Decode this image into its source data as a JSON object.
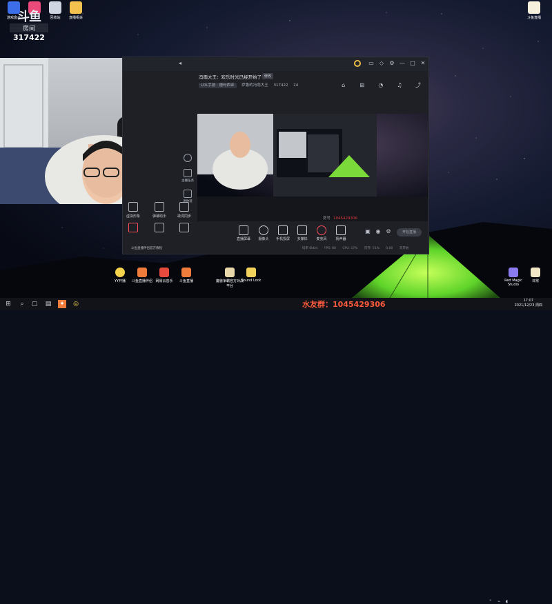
{
  "overlay": {
    "logo_glyph": "斗鱼",
    "logo_text": "房间",
    "room_number": "317422"
  },
  "desktop_icons_top": [
    {
      "label": "游戏盒子"
    },
    {
      "label": ""
    },
    {
      "label": "回收站"
    },
    {
      "label": "直播相关"
    }
  ],
  "desktop_icon_right": {
    "label": "斗鱼直播"
  },
  "app": {
    "room_title": "冯雨大王：欢乐时光已经开始了～",
    "title_tag": "修改",
    "category_chip": "LOL手游 · 德玛西亚",
    "streamer_name": "萨鲁的冯雨大王",
    "room_number": "317422",
    "fans_count": "24",
    "left_rail": [
      {
        "label": "主播任务"
      },
      {
        "label": "迷你装"
      }
    ],
    "bottom_tools": [
      {
        "label": "虚拟形象"
      },
      {
        "label": "弹幕助手"
      },
      {
        "label": "歌词同步"
      },
      {
        "label": ""
      },
      {
        "label": ""
      },
      {
        "label": ""
      }
    ],
    "notice": "斗鱼直播伴侣官方教程",
    "live_label": "房号",
    "live_id": "1045429306",
    "controls": [
      {
        "label": "直播屏幕"
      },
      {
        "label": "摄像头"
      },
      {
        "label": "手机投屏"
      },
      {
        "label": "多媒体"
      },
      {
        "label": "麦克风"
      },
      {
        "label": "扬声器"
      }
    ],
    "start_button": "开始直播",
    "status": [
      "码率 0kb/s",
      "FPS: 60",
      "CPU: 17%",
      "内存: 51%",
      "0.00",
      "未开始"
    ]
  },
  "bottom_icons": [
    {
      "label": "YY开播"
    },
    {
      "label": "斗鱼直播伴侣"
    },
    {
      "label": "网易云音乐"
    },
    {
      "label": "斗鱼直播"
    },
    {
      "label": "魔兽争霸官方对战平台"
    },
    {
      "label": "Sound Lock"
    },
    {
      "label": "Red Magic Studio"
    },
    {
      "label": "日常"
    }
  ],
  "taskbar": {
    "qq_group": "水友群：1045429306",
    "time": "17:07",
    "date": "2021/12/23 周四"
  },
  "colors": {
    "accent_red": "#ff4d5e",
    "qq_text": "#ff5a3c",
    "tent_green": "#7cff3a"
  }
}
